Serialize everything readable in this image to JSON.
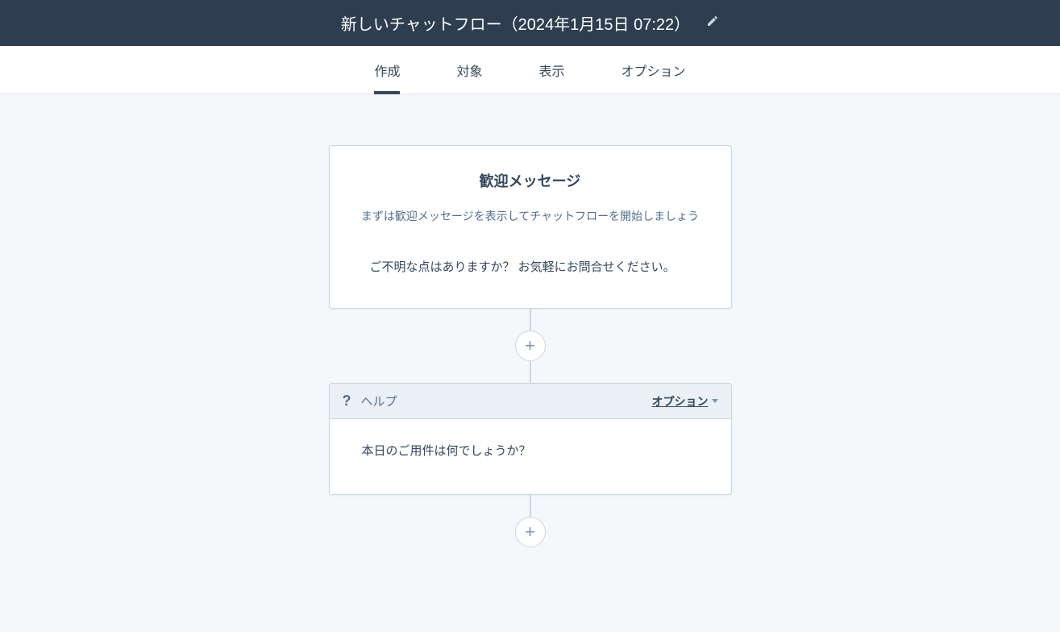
{
  "header": {
    "title": "新しいチャットフロー（2024年1月15日 07:22）"
  },
  "nav": {
    "items": [
      {
        "label": "作成",
        "active": true
      },
      {
        "label": "対象",
        "active": false
      },
      {
        "label": "表示",
        "active": false
      },
      {
        "label": "オプション",
        "active": false
      }
    ]
  },
  "welcome_card": {
    "title": "歓迎メッセージ",
    "subtitle": "まずは歓迎メッセージを表示してチャットフローを開始しましょう",
    "body": "ご不明な点はありますか？ お気軽にお問合せください。"
  },
  "help_card": {
    "icon": "?",
    "label": "ヘルプ",
    "options_label": "オプション",
    "body": "本日のご用件は何でしょうか？"
  }
}
